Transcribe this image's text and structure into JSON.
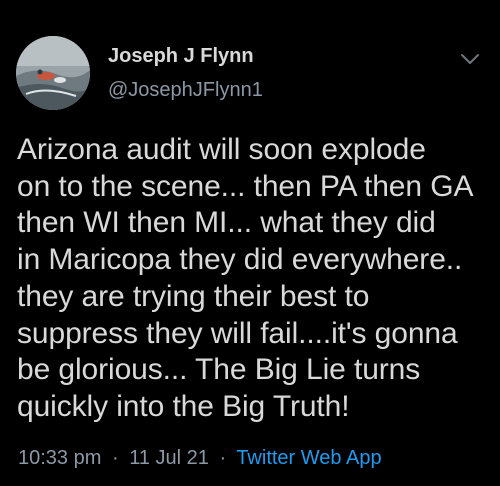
{
  "author": {
    "display_name": "Joseph J Flynn",
    "handle": "@JosephJFlynn1"
  },
  "tweet": {
    "text": "Arizona audit will soon explode\non to the scene... then PA then GA\nthen WI then MI... what they did\nin Maricopa they did everywhere..\nthey are trying their best to\nsuppress they will fail....it's gonna\nbe glorious... The Big Lie turns\nquickly into the Big Truth!",
    "time": "10:33 pm",
    "separator": "·",
    "date": "11 Jul 21",
    "source": "Twitter Web App"
  },
  "icons": {
    "menu": "chevron-down-icon",
    "avatar": "profile-photo"
  },
  "colors": {
    "background": "#000000",
    "text": "#d9d9d9",
    "secondary": "#8b98a5",
    "link": "#1d9bf0"
  }
}
